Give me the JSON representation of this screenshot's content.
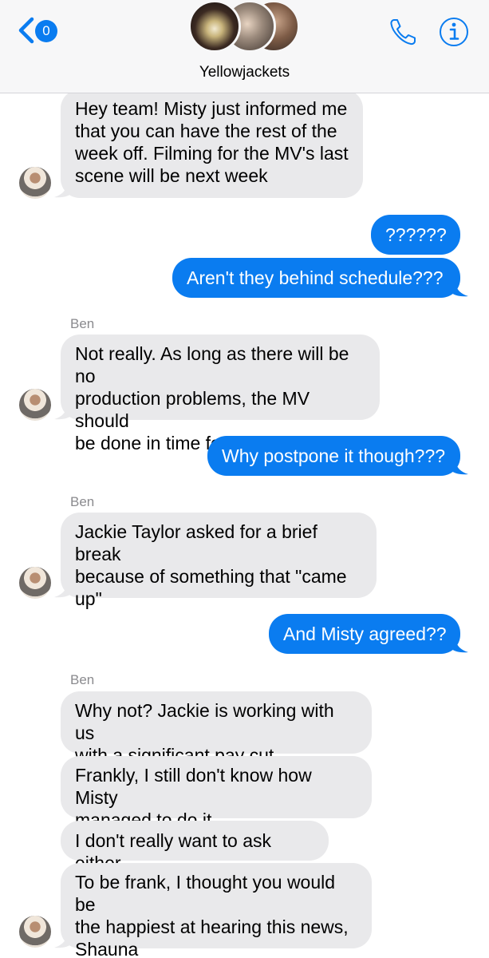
{
  "header": {
    "back_badge_count": "0",
    "group_name": "Yellowjackets",
    "icons": [
      "chevron-left-icon",
      "phone-icon",
      "info-icon"
    ],
    "accent_color": "#0a7cf0"
  },
  "messages": [
    {
      "from": "other",
      "text": "Hey team! Misty just informed me\nthat you can have the rest of the\nweek off. Filming for the MV's last\nscene will be next week"
    },
    {
      "from": "me",
      "text": "??????"
    },
    {
      "from": "me",
      "text": "Aren't they behind schedule???"
    },
    {
      "from": "other",
      "sender": "Ben",
      "text": "Not really. As long as there will be no\nproduction problems, the MV should\nbe done in time for their debut"
    },
    {
      "from": "me",
      "text": "Why postpone it though???"
    },
    {
      "from": "other",
      "sender": "Ben",
      "text": "Jackie Taylor asked for a brief break\nbecause of something that \"came\nup\""
    },
    {
      "from": "me",
      "text": "And Misty agreed??"
    },
    {
      "from": "other",
      "sender": "Ben",
      "text": "Why not? Jackie is working with us\nwith a significant pay cut"
    },
    {
      "from": "other",
      "text": "Frankly, I still don't know how Misty\nmanaged to do it"
    },
    {
      "from": "other",
      "text": "I don't really want to ask either"
    },
    {
      "from": "other",
      "text": "To be frank, I thought you would be\nthe happiest at hearing this news,\nShauna"
    }
  ]
}
